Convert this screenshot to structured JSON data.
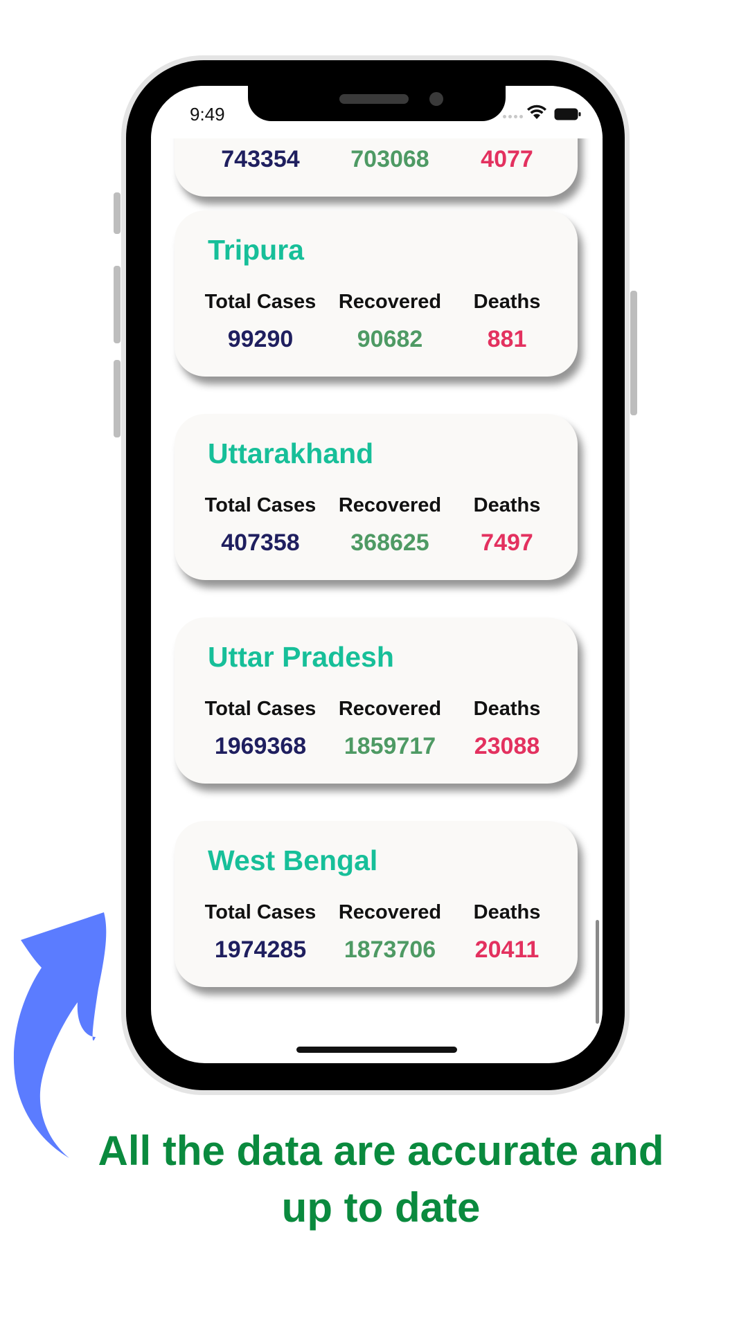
{
  "status_bar": {
    "time": "9:49"
  },
  "top_partial_card": {
    "total": "743354",
    "recovered": "703068",
    "deaths": "4077"
  },
  "labels": {
    "total": "Total Cases",
    "recovered": "Recovered",
    "deaths": "Deaths"
  },
  "cards": [
    {
      "name": "Tripura",
      "total": "99290",
      "recovered": "90682",
      "deaths": "881"
    },
    {
      "name": "Uttarakhand",
      "total": "407358",
      "recovered": "368625",
      "deaths": "7497"
    },
    {
      "name": "Uttar Pradesh",
      "total": "1969368",
      "recovered": "1859717",
      "deaths": "23088"
    },
    {
      "name": "West Bengal",
      "total": "1974285",
      "recovered": "1873706",
      "deaths": "20411"
    }
  ],
  "caption": {
    "line1": "All the data are accurate and",
    "line2": "up to date"
  },
  "colors": {
    "state_name": "#17bf99",
    "total": "#1f1f5f",
    "recovered": "#4e9a64",
    "deaths": "#e3315f",
    "caption": "#0a8a3e",
    "arrow": "#5b7cff"
  },
  "icons": [
    "wifi-icon",
    "battery-icon",
    "arrow-icon"
  ]
}
